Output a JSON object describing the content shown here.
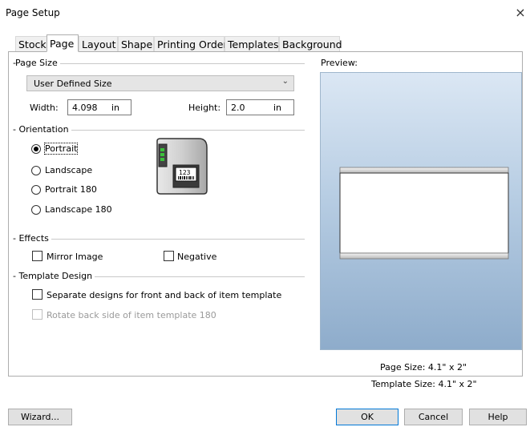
{
  "dialog": {
    "title": "Page Setup",
    "close_glyph": "×"
  },
  "tabs": [
    {
      "label": "Stock",
      "active": false
    },
    {
      "label": "Page",
      "active": true
    },
    {
      "label": "Layout",
      "active": false
    },
    {
      "label": "Shape",
      "active": false
    },
    {
      "label": "Printing Order",
      "active": false
    },
    {
      "label": "Templates",
      "active": false
    },
    {
      "label": "Background",
      "active": false
    }
  ],
  "page_size": {
    "group_label": "Page Size",
    "selected": "User Defined Size",
    "width_label": "Width:",
    "width_value": "4.098",
    "width_unit": "in",
    "height_label": "Height:",
    "height_value": "2.0",
    "height_unit": "in"
  },
  "orientation": {
    "group_label": "Orientation",
    "options": [
      {
        "label": "Portrait",
        "selected": true
      },
      {
        "label": "Landscape",
        "selected": false
      },
      {
        "label": "Portrait 180",
        "selected": false
      },
      {
        "label": "Landscape 180",
        "selected": false
      }
    ],
    "printer_label_text": "123"
  },
  "effects": {
    "group_label": "Effects",
    "mirror_label": "Mirror Image",
    "mirror_checked": false,
    "negative_label": "Negative",
    "negative_checked": false
  },
  "template_design": {
    "group_label": "Template Design",
    "separate_label": "Separate designs for front and back of item template",
    "separate_checked": false,
    "rotate_label": "Rotate back side of item template 180",
    "rotate_checked": false,
    "rotate_disabled": true
  },
  "preview": {
    "label": "Preview:",
    "page_size_text": "Page Size:  4.1\" x 2\"",
    "template_size_text": "Template Size:  4.1\" x 2\""
  },
  "buttons": {
    "wizard": "Wizard...",
    "ok": "OK",
    "cancel": "Cancel",
    "help": "Help"
  },
  "colors": {
    "default_button_border": "#0078d7",
    "preview_top": "#dbe7f4",
    "preview_bottom": "#8eaccb"
  }
}
